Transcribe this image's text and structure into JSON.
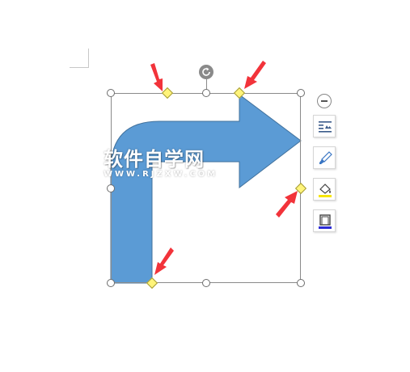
{
  "watermark": {
    "title": "软件自学网",
    "url": "WWW.RJZXW.COM"
  },
  "colors": {
    "shape_fill": "#5b9bd5",
    "shape_stroke": "#41719c",
    "adjust_handle": "#fff47a",
    "arrow_marker": "#f2333a"
  },
  "float_toolbar": {
    "collapse_icon": "minus-circle-icon",
    "tools": [
      "text-wrap-icon",
      "shape-style-icon",
      "shape-fill-icon",
      "shape-outline-icon"
    ]
  }
}
